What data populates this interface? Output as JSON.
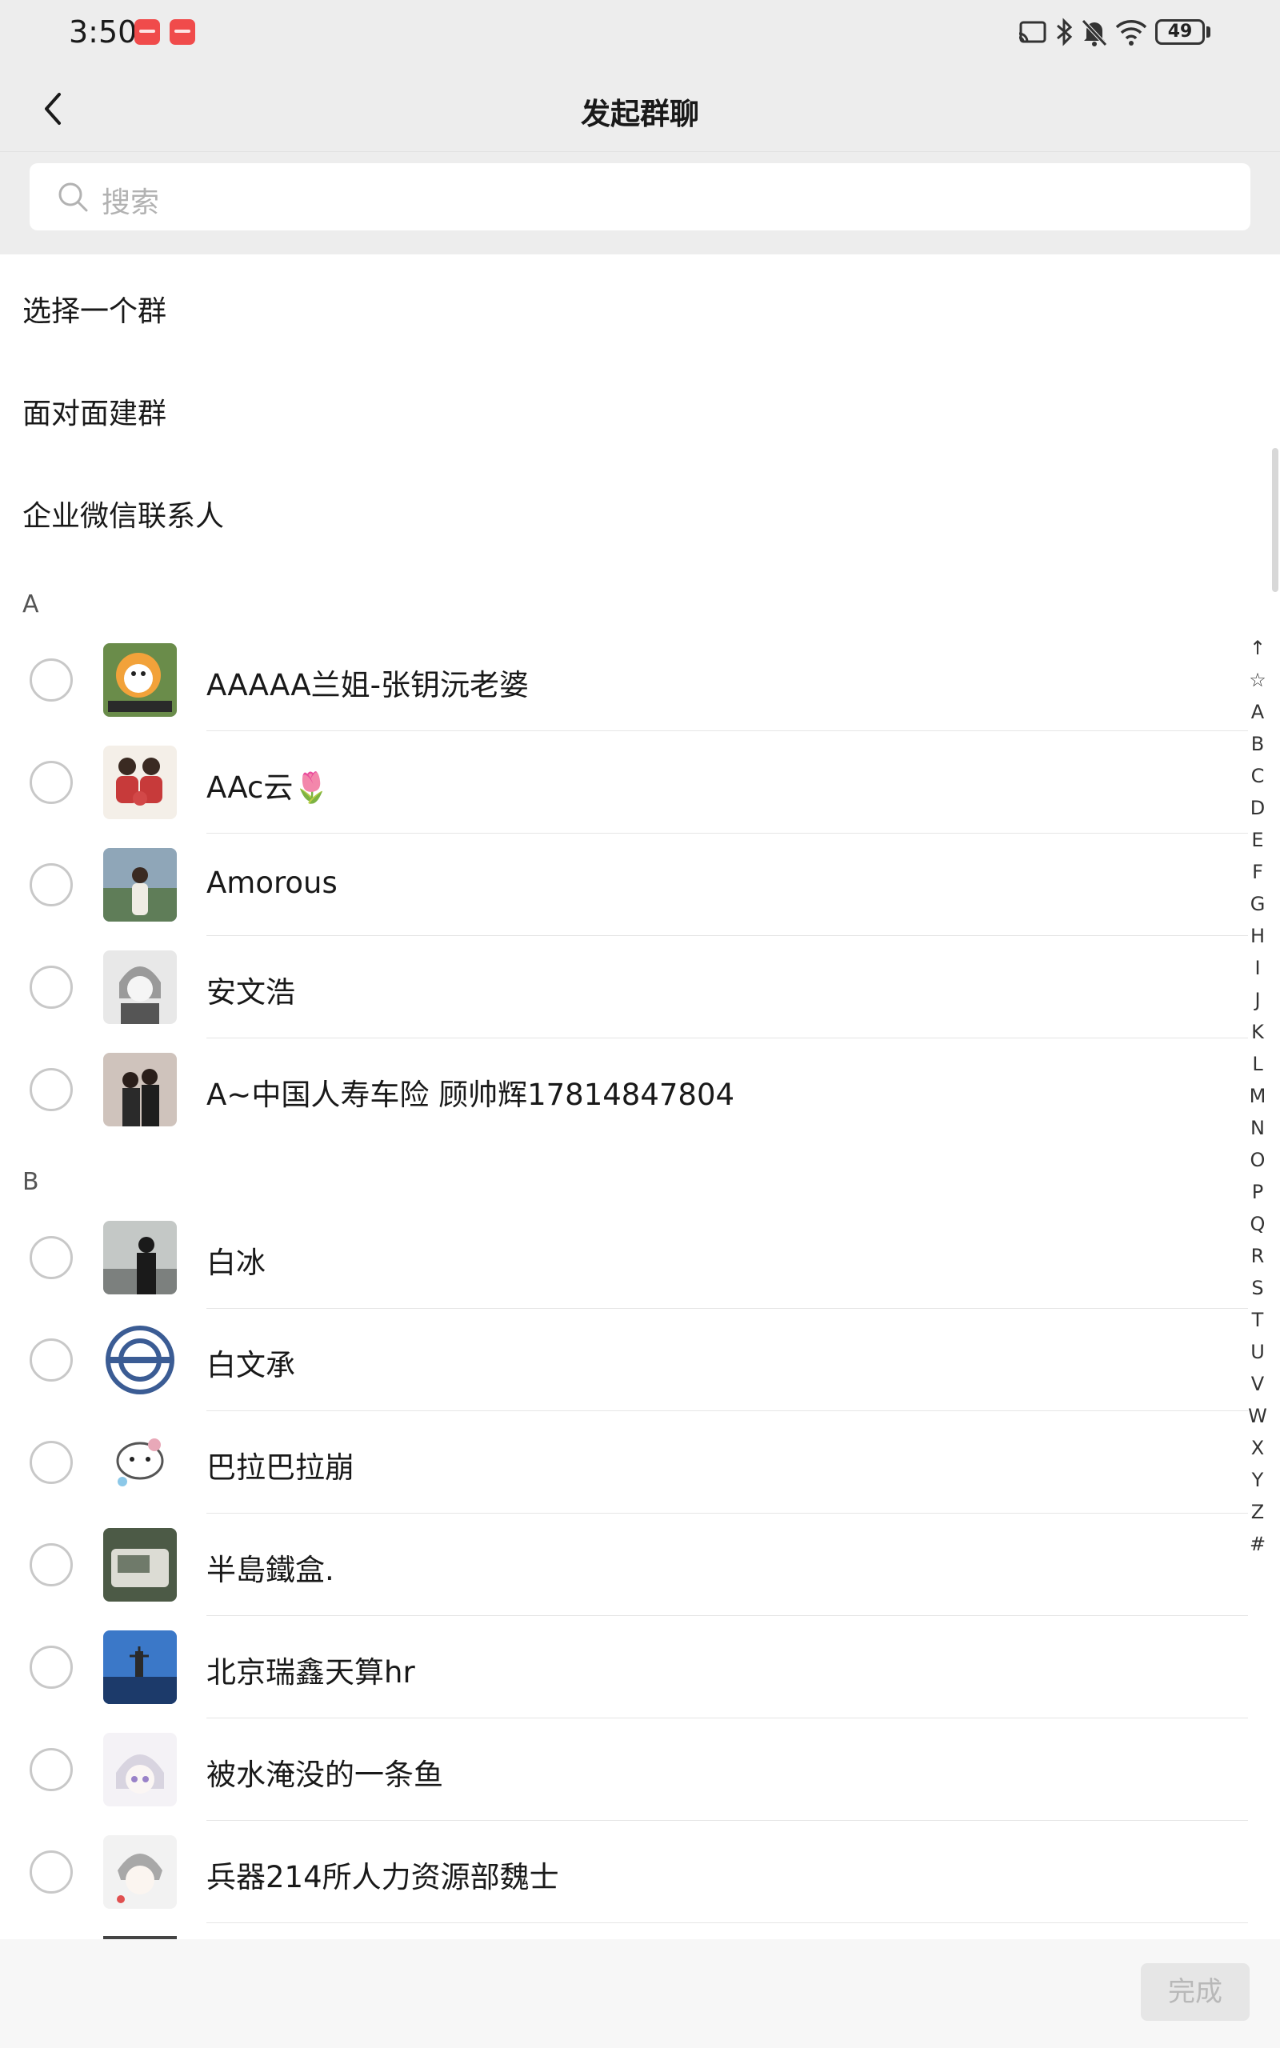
{
  "status_bar": {
    "time": "3:50",
    "battery": "49",
    "icons": [
      "app-notification-icon",
      "app-notification-icon",
      "cast-icon",
      "bluetooth-icon",
      "mute-bell-icon",
      "wifi-icon",
      "battery-icon"
    ]
  },
  "nav": {
    "title": "发起群聊",
    "back_icon": "chevron-left-icon"
  },
  "search": {
    "placeholder": "搜索",
    "icon": "search-icon"
  },
  "menu": [
    {
      "label": "选择一个群"
    },
    {
      "label": "面对面建群"
    },
    {
      "label": "企业微信联系人"
    }
  ],
  "sections": [
    {
      "letter": "A",
      "contacts": [
        {
          "name": "AAAAA兰姐-张钥沅老婆",
          "avatar_color": "#6a8c4a"
        },
        {
          "name": "AAc云",
          "emoji": "🌷",
          "avatar_color": "#c73a3a"
        },
        {
          "name": "Amorous",
          "avatar_color": "#5f7d58"
        },
        {
          "name": "安文浩",
          "avatar_color": "#8a8a8a"
        },
        {
          "name": "A~中国人寿车险 顾帅辉17814847804",
          "avatar_color": "#6d5a55"
        }
      ]
    },
    {
      "letter": "B",
      "contacts": [
        {
          "name": "白冰",
          "avatar_color": "#9a9e9c"
        },
        {
          "name": "白文承",
          "avatar_color": "#3b5c94"
        },
        {
          "name": "巴拉巴拉崩",
          "avatar_color": "#e8a8b8"
        },
        {
          "name": "半島鐵盒.",
          "avatar_color": "#4c5a46"
        },
        {
          "name": "北京瑞鑫天算hr",
          "avatar_color": "#2f5a9a"
        },
        {
          "name": "被水淹没的一条鱼",
          "avatar_color": "#c8c0d8"
        },
        {
          "name": "兵器214所人力资源部魏士",
          "avatar_color": "#a8a8a8"
        }
      ]
    }
  ],
  "alpha_index": [
    "↑",
    "☆",
    "A",
    "B",
    "C",
    "D",
    "E",
    "F",
    "G",
    "H",
    "I",
    "J",
    "K",
    "L",
    "M",
    "N",
    "O",
    "P",
    "Q",
    "R",
    "S",
    "T",
    "U",
    "V",
    "W",
    "X",
    "Y",
    "Z",
    "#"
  ],
  "bottom": {
    "done_label": "完成"
  },
  "colors": {
    "header_bg": "#ededed",
    "notification_badge": "#f04b4b",
    "done_disabled_bg": "#e6e6e6"
  }
}
